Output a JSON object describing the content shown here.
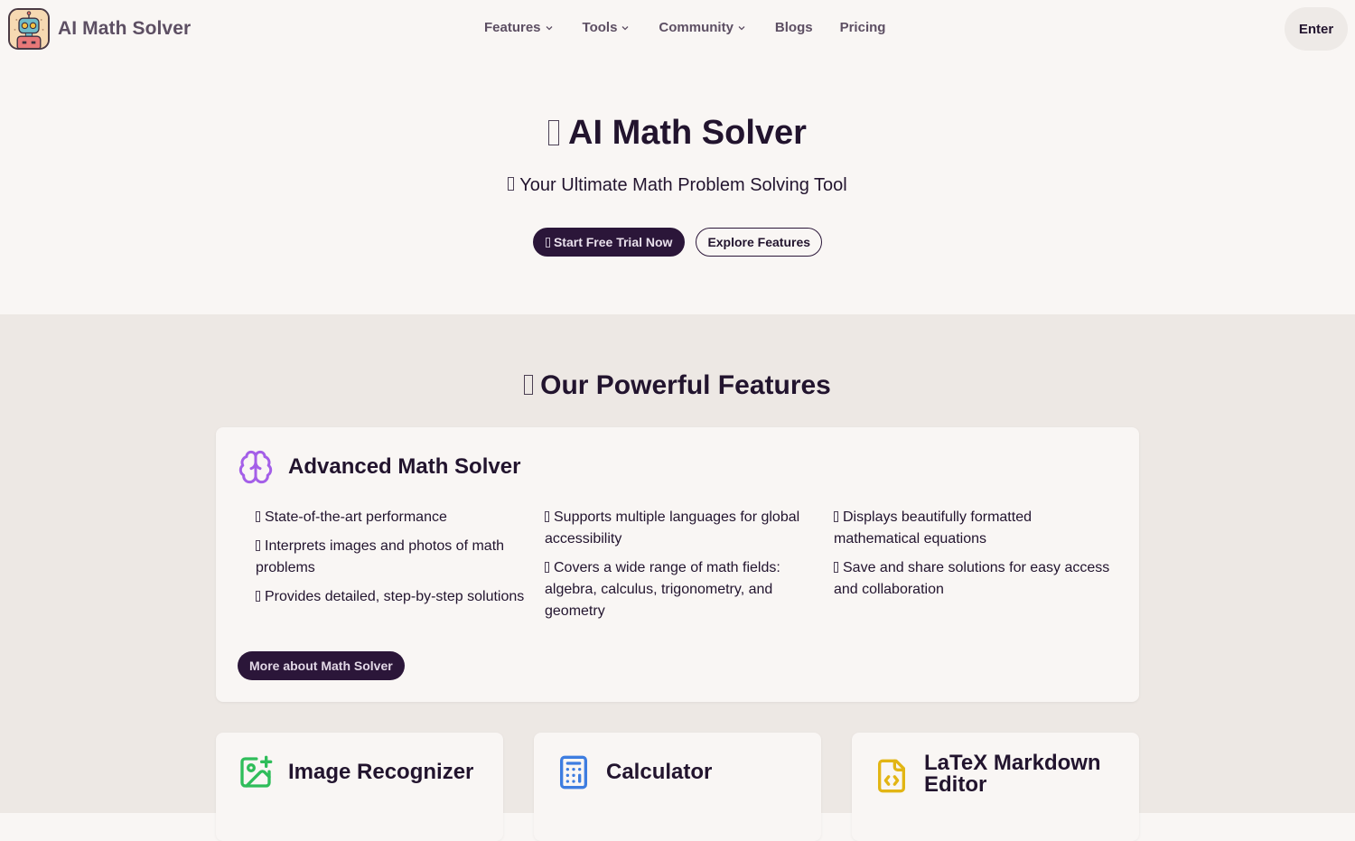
{
  "nav": {
    "brand_name": "AI Math Solver",
    "logo_icon": "robot-logo-icon",
    "links": [
      {
        "label": "Features",
        "has_dropdown": true
      },
      {
        "label": "Tools",
        "has_dropdown": true
      },
      {
        "label": "Community",
        "has_dropdown": true
      },
      {
        "label": "Blogs",
        "has_dropdown": false
      },
      {
        "label": "Pricing",
        "has_dropdown": false
      }
    ],
    "enter_label": "Enter"
  },
  "hero": {
    "title": "AI Math Solver",
    "subtitle": "Your Ultimate Math Problem Solving Tool",
    "primary_button": "Start Free Trial Now",
    "secondary_button": "Explore Features"
  },
  "features": {
    "title": "Our Powerful Features",
    "main_card": {
      "icon": "brain-icon",
      "icon_color": "#a45fe8",
      "title": "Advanced Math Solver",
      "columns": [
        [
          "State-of-the-art performance",
          "Interprets images and photos of math problems",
          "Provides detailed, step-by-step solutions"
        ],
        [
          "Supports multiple languages for global accessibility",
          "Covers a wide range of math fields: algebra, calculus, trigonometry, and geometry"
        ],
        [
          "Displays beautifully formatted mathematical equations",
          "Save and share solutions for easy access and collaboration"
        ]
      ],
      "button": "More about Math Solver"
    },
    "cards": [
      {
        "icon": "image-plus-icon",
        "icon_color": "#2fbd5a",
        "title": "Image Recognizer"
      },
      {
        "icon": "calculator-icon",
        "icon_color": "#3e7de0",
        "title": "Calculator"
      },
      {
        "icon": "file-code-icon",
        "icon_color": "#e2b514",
        "title": "LaTeX Markdown Editor"
      }
    ]
  },
  "colors": {
    "background": "#f9f6f4",
    "section_background": "#ede8e4",
    "primary": "#2b1639",
    "text": "#22142e",
    "nav_text": "#5d4f63"
  }
}
